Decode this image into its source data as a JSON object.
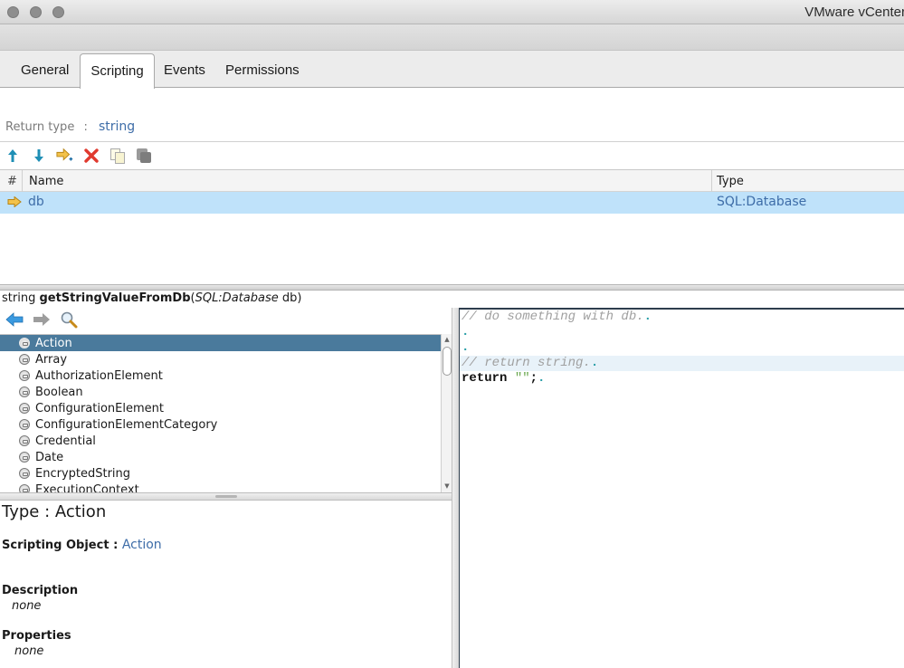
{
  "window": {
    "title": "VMware vCenter"
  },
  "tabs": [
    {
      "label": "General",
      "active": false
    },
    {
      "label": "Scripting",
      "active": true
    },
    {
      "label": "Events",
      "active": false
    },
    {
      "label": "Permissions",
      "active": false
    }
  ],
  "return_type": {
    "label": "Return type",
    "separator": ":",
    "value": "string"
  },
  "param_toolbar": {
    "icons": [
      "arrow-up-icon",
      "arrow-down-icon",
      "add-parameter-icon",
      "delete-icon",
      "copy-icon",
      "paste-icon"
    ]
  },
  "params_table": {
    "columns": [
      "#",
      "Name",
      "Type"
    ],
    "rows": [
      {
        "name": "db",
        "type": "SQL:Database",
        "selected": true
      }
    ]
  },
  "signature": {
    "return_type": "string",
    "function_name": "getStringValueFromDb",
    "open_paren": "(",
    "param_type": "SQL:Database",
    "param_name": " db",
    "close_paren": ")"
  },
  "api_explorer": {
    "nav_icons": [
      "back-icon",
      "forward-icon",
      "search-icon"
    ],
    "types": [
      {
        "label": "Action",
        "selected": true
      },
      {
        "label": "Array",
        "selected": false
      },
      {
        "label": "AuthorizationElement",
        "selected": false
      },
      {
        "label": "Boolean",
        "selected": false
      },
      {
        "label": "ConfigurationElement",
        "selected": false
      },
      {
        "label": "ConfigurationElementCategory",
        "selected": false
      },
      {
        "label": "Credential",
        "selected": false
      },
      {
        "label": "Date",
        "selected": false
      },
      {
        "label": "EncryptedString",
        "selected": false
      },
      {
        "label": "ExecutionContext",
        "selected": false
      }
    ]
  },
  "details": {
    "type_heading": "Type : Action",
    "scripting_object_label": "Scripting Object : ",
    "scripting_object_value": "Action",
    "description_label": "Description",
    "description_value": "none",
    "properties_label": "Properties",
    "properties_value": "none"
  },
  "editor": {
    "lines": [
      {
        "kind": "comment",
        "text": "// do something with db."
      },
      {
        "kind": "empty",
        "text": ""
      },
      {
        "kind": "empty",
        "text": ""
      },
      {
        "kind": "comment",
        "text": "// return string.",
        "highlighted": true
      },
      {
        "kind": "code",
        "keyword": "return",
        "string": "\"\"",
        "tail": ";"
      }
    ]
  }
}
